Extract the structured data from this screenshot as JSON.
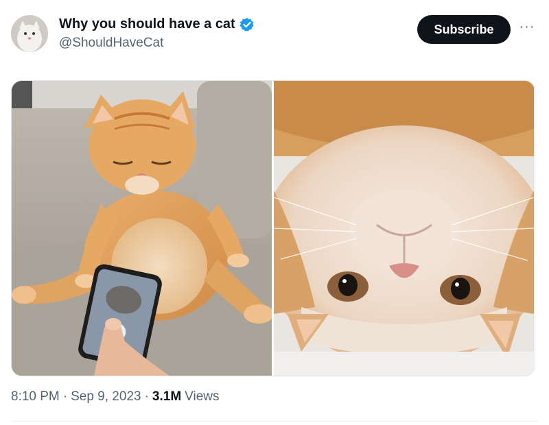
{
  "post": {
    "author": {
      "display_name": "Why you should have a cat",
      "handle": "@ShouldHaveCat",
      "verified": true,
      "verified_color": "#1d9bf0"
    },
    "subscribe_label": "Subscribe",
    "more_label": "···",
    "media": [
      {
        "description": "orange cat sitting on couch looking at phone"
      },
      {
        "description": "orange cat face upside down close-up"
      }
    ],
    "time": "8:10 PM",
    "separator": "·",
    "date": "Sep 9, 2023",
    "views_count": "3.1M",
    "views_label": "Views"
  }
}
